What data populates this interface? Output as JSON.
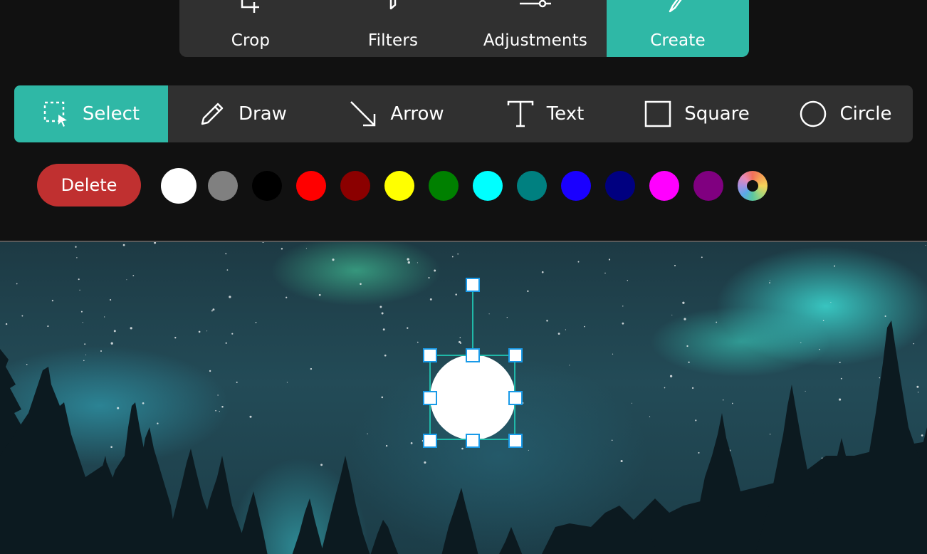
{
  "top_tabs": [
    {
      "label": "Crop",
      "icon": "crop-icon",
      "active": false
    },
    {
      "label": "Filters",
      "icon": "filter-icon",
      "active": false
    },
    {
      "label": "Adjustments",
      "icon": "sliders-icon",
      "active": false
    },
    {
      "label": "Create",
      "icon": "pen-nib-icon",
      "active": true
    }
  ],
  "tools": [
    {
      "label": "Select",
      "icon": "select-icon",
      "active": true
    },
    {
      "label": "Draw",
      "icon": "pencil-icon",
      "active": false
    },
    {
      "label": "Arrow",
      "icon": "arrow-icon",
      "active": false
    },
    {
      "label": "Text",
      "icon": "text-icon",
      "active": false
    },
    {
      "label": "Square",
      "icon": "square-icon",
      "active": false
    },
    {
      "label": "Circle",
      "icon": "circle-icon",
      "active": false
    }
  ],
  "actions": {
    "delete_label": "Delete"
  },
  "colors": {
    "accent": "#2fb8a6",
    "delete": "#c03030",
    "handle_border": "#1a9ae8",
    "palette": [
      "#ffffff",
      "#808080",
      "#000000",
      "#ff0000",
      "#8b0000",
      "#ffff00",
      "#008000",
      "#00ffff",
      "#008080",
      "#1a00ff",
      "#000080",
      "#ff00ff",
      "#800080"
    ],
    "selected_color": "#ffffff"
  },
  "canvas": {
    "image": "aurora-night-forest",
    "selected_shape": {
      "type": "circle",
      "fill": "#ffffff"
    }
  }
}
